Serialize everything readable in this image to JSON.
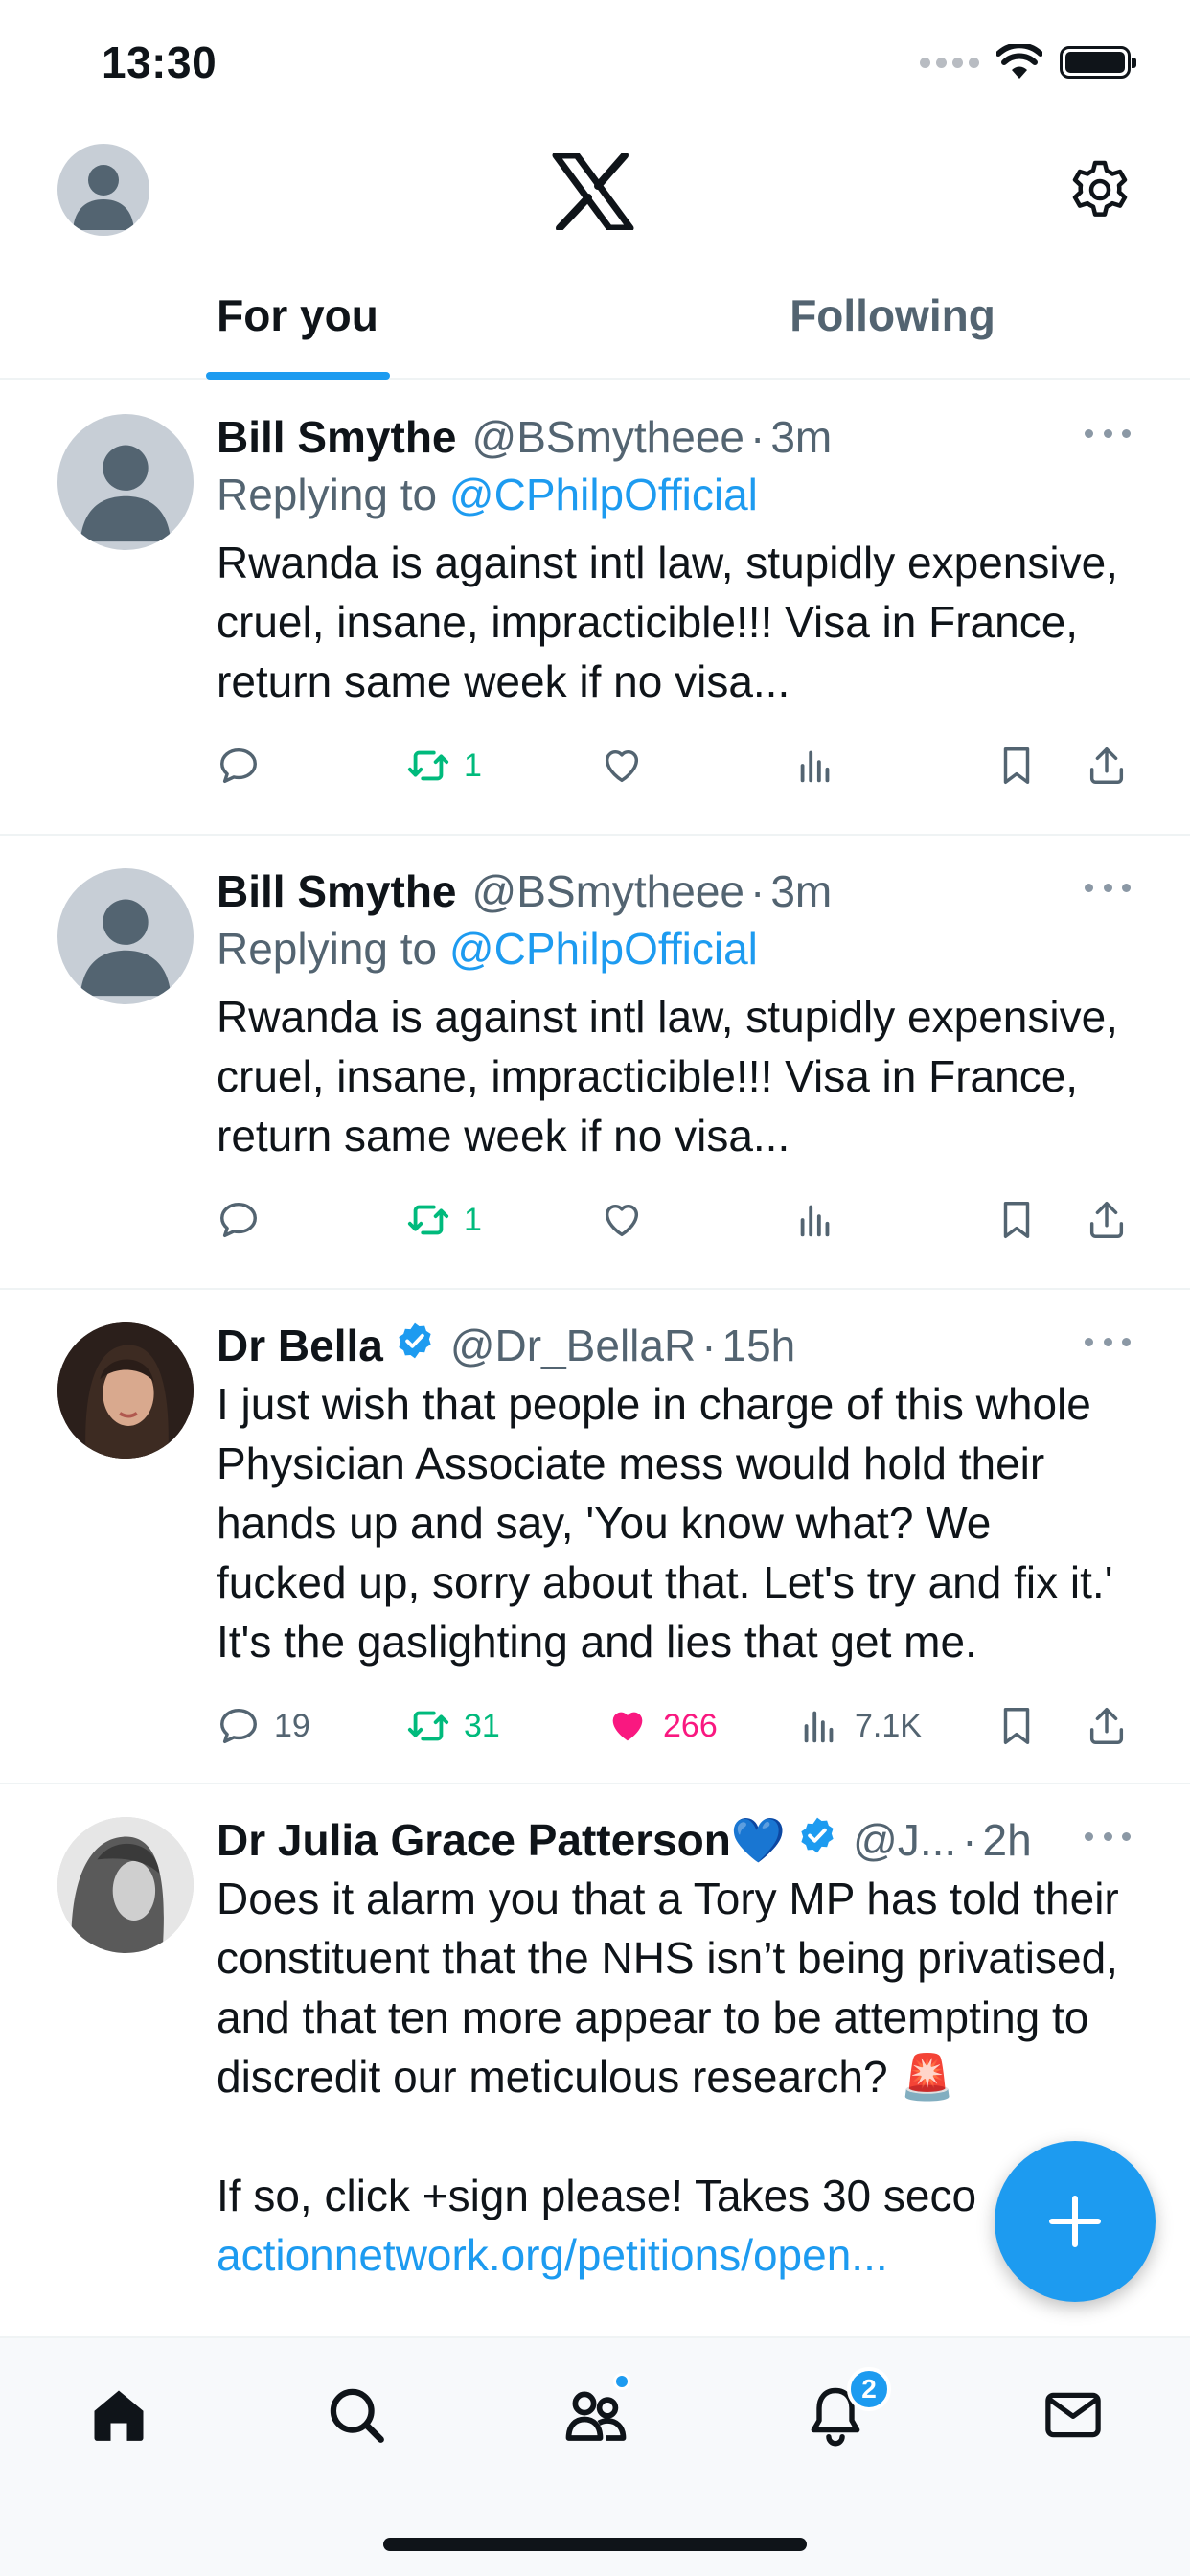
{
  "status_bar": {
    "time": "13:30"
  },
  "header": {
    "logo": "x-logo",
    "settings_icon": "gear-icon"
  },
  "tabs": [
    {
      "label": "For you",
      "active": true
    },
    {
      "label": "Following",
      "active": false
    }
  ],
  "tweets": [
    {
      "name": "Bill Smythe",
      "handle": "@BSmytheee",
      "sep": "·",
      "time": "3m",
      "replying_prefix": "Replying to ",
      "replying_to": "@CPhilpOfficial",
      "text": "Rwanda is against intl law, stupidly expensive, cruel, insane, impracticible!!! Visa in France, return same week if no visa...",
      "replies": "",
      "retweets": "1",
      "likes": "",
      "views": ""
    },
    {
      "name": "Bill Smythe",
      "handle": "@BSmytheee",
      "sep": "·",
      "time": "3m",
      "replying_prefix": "Replying to ",
      "replying_to": "@CPhilpOfficial",
      "text": "Rwanda is against intl law, stupidly expensive, cruel, insane, impracticible!!! Visa in France, return same week if no visa...",
      "replies": "",
      "retweets": "1",
      "likes": "",
      "views": ""
    },
    {
      "name": "Dr Bella",
      "handle": "@Dr_BellaR",
      "sep": "·",
      "time": "15h",
      "verified": true,
      "text": "I just wish that people in charge of this whole Physician Associate mess would hold their hands up and say, 'You know what? We fucked up, sorry about that. Let's try and fix it.' It's the gaslighting and lies that get me.",
      "replies": "19",
      "retweets": "31",
      "likes": "266",
      "views": "7.1K",
      "liked": true
    },
    {
      "name": "Dr Julia Grace Patterson💙",
      "handle": "@J...",
      "sep": "·",
      "time": "2h",
      "verified": true,
      "text": "Does it alarm you that a Tory MP has told their constituent that the NHS isn’t being privatised, and that ten more appear to be attempting to discredit our meticulous research? 🚨\n\nIf so, click +sign please! Takes 30 seco",
      "link": "actionnetwork.org/petitions/open..."
    }
  ],
  "fab": {
    "icon": "plus-icon"
  },
  "tab_bar": {
    "items": [
      "home-icon",
      "search-icon",
      "communities-icon",
      "notifications-icon",
      "messages-icon"
    ],
    "notifications_badge": "2"
  },
  "colors": {
    "accent": "#1d9bf0",
    "retweet": "#00ba7c",
    "like": "#f91880",
    "secondary_text": "#536471"
  }
}
